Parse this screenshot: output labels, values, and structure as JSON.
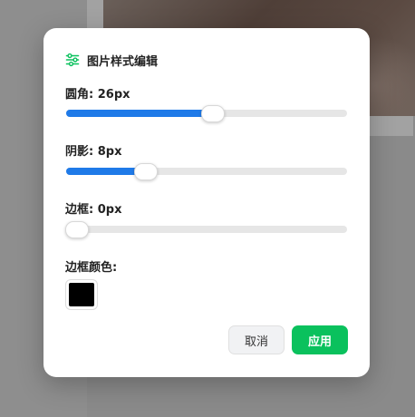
{
  "dialog": {
    "title": "图片样式编辑",
    "title_icon": "sliders-icon",
    "radius": {
      "label": "圆角: 26px",
      "value": 26,
      "fill_fraction": 0.52
    },
    "shadow": {
      "label": "阴影: 8px",
      "value": 8,
      "fill_fraction": 0.28
    },
    "border": {
      "label": "边框: 0px",
      "value": 0,
      "fill_fraction": 0.035
    },
    "border_color": {
      "label": "边框颜色:",
      "value": "#000000"
    },
    "buttons": {
      "cancel": "取消",
      "apply": "应用"
    }
  },
  "colors": {
    "accent": "#1f7ae8",
    "apply": "#0ac15d",
    "icon": "#0ac15d"
  }
}
